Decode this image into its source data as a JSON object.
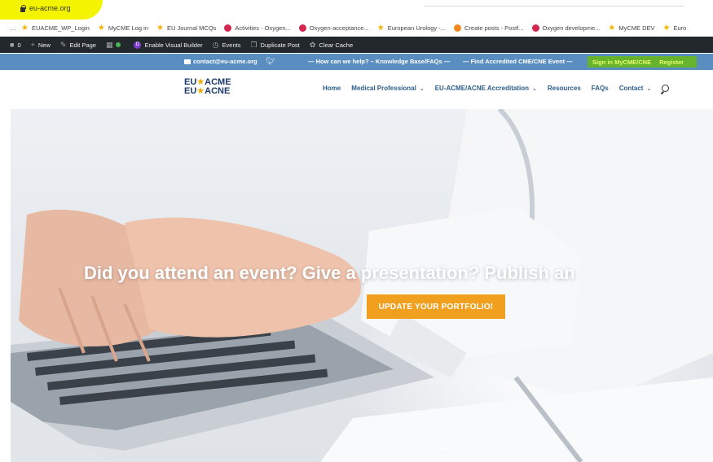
{
  "browser": {
    "address": "eu-acme.org"
  },
  "bookmarks": [
    {
      "label": "EUACME_WP_Login",
      "icon": "star-icon"
    },
    {
      "label": "MyCME Log in",
      "icon": "star-icon"
    },
    {
      "label": "EU Journal MCQs",
      "icon": "star-icon"
    },
    {
      "label": "Activities - Oxygen...",
      "icon": "oxygen-icon"
    },
    {
      "label": "Oxygen-acceptance...",
      "icon": "oxygen-icon"
    },
    {
      "label": "European Urology -...",
      "icon": "star-icon"
    },
    {
      "label": "Create posts - Postf...",
      "icon": "postfity-icon"
    },
    {
      "label": "Oxygen developme...",
      "icon": "oxygen-icon"
    },
    {
      "label": "MyCME DEV",
      "icon": "star-icon"
    },
    {
      "label": "Euro",
      "icon": "star-icon"
    }
  ],
  "admin_bar": {
    "comments_count": "0",
    "new_label": "New",
    "edit_page_label": "Edit Page",
    "visual_builder_label": "Enable Visual Builder",
    "events_label": "Events",
    "duplicate_label": "Duplicate Post",
    "clear_cache_label": "Clear Cache"
  },
  "topbar": {
    "email": "contact@eu-acme.org",
    "help_link": "— How can we help? – Knowledge Base/FAQs —",
    "find_link": "— Find Accredited CME/CNE Event —",
    "signin": "Sign in MyCME/CNE",
    "register": "Register"
  },
  "logo": {
    "line1_a": "EU",
    "line1_b": "ACME",
    "line2_a": "EU",
    "line2_b": "ACNE"
  },
  "nav": {
    "home": "Home",
    "medical_professional": "Medical Professional",
    "accreditation": "EU-ACME/ACNE Accreditation",
    "resources": "Resources",
    "faqs": "FAQs",
    "contact": "Contact"
  },
  "hero": {
    "title": "Did you attend an event? Give a presentation? Publish an",
    "button": "UPDATE YOUR PORTFOLIO!"
  },
  "colors": {
    "topbar_bg": "#5b8ec0",
    "signin_bg": "#66b32e",
    "button_bg": "#f0a01e",
    "nav_text": "#2b5d8a",
    "admin_bg": "#23282d"
  }
}
